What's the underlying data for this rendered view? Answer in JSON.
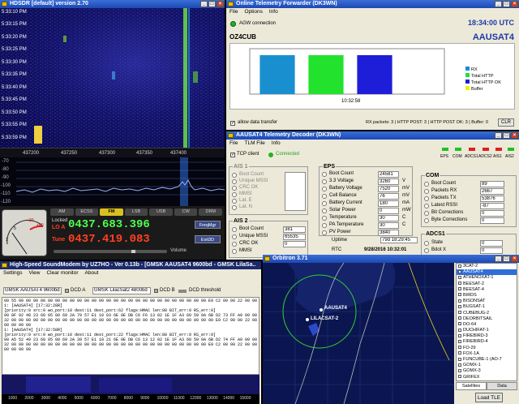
{
  "hdsdr": {
    "title": "HDSDR [default] version 2.70",
    "times": [
      "5:33:10 PM",
      "5:33:15 PM",
      "5:33:20 PM",
      "5:33:25 PM",
      "5:33:30 PM",
      "5:33:35 PM",
      "5:33:40 PM",
      "5:33:45 PM",
      "5:33:50 PM",
      "5:33:55 PM",
      "5:33:59 PM"
    ],
    "freq_ticks": [
      "437200",
      "437250",
      "437300",
      "437350",
      "437400"
    ],
    "db_ticks": [
      "-70",
      "-80",
      "-90",
      "-100",
      "-110",
      "-120"
    ],
    "modes": [
      "AM",
      "ECSS",
      "FM",
      "LSB",
      "USB",
      "CW",
      "DRM"
    ],
    "active_mode": "FM",
    "lo_label": "LO A",
    "lo_freq": "0437.683.396",
    "tune_label": "Tune",
    "tune_freq": "0437.419.083",
    "locked": "Locked",
    "freqmgr": "FreqMgr",
    "exit": "Exit3D",
    "volume_label": "Volume",
    "meter_scale": [
      "1",
      "3",
      "5",
      "7",
      "9",
      "+20",
      "+40",
      "+60"
    ]
  },
  "otf": {
    "title": "Online Telemetry Forwarder (DK3WN)",
    "menu": [
      "File",
      "Options",
      "Info"
    ],
    "clock": "18:34:00 UTC",
    "agw": "AGW connection",
    "callsign": "OZ4CUB",
    "sat": "AAUSAT4",
    "chart_time": "10:32:58",
    "allow": "allow data transfer",
    "status": "RX packets: 3 | HTTP POST: 3 | HTTP POST OK: 3 | Buffer: 0",
    "clr": "CLR",
    "chart_data": {
      "type": "bar",
      "title": "",
      "categories": [
        "RX",
        "Total HTTP",
        "Total HTTP OK",
        "Buffer"
      ],
      "values": [
        3,
        3,
        3,
        0
      ],
      "colors": [
        "#1a8fd0",
        "#22e22e",
        "#1e1ed8",
        "#f0f000"
      ],
      "ylim": [
        0,
        3.5
      ],
      "xlabel": "",
      "ylabel": "",
      "legend": "right",
      "grid": false
    }
  },
  "decoder": {
    "title": "AAUSAT4 Telemetry Decoder (DK3WN)",
    "menu": [
      "File",
      "TLM File",
      "Info"
    ],
    "tcp": "TCP client",
    "connected": "Connected",
    "leds": [
      "EPS",
      "COM",
      "ADCS1",
      "ADCS2",
      "AIS1",
      "AIS2"
    ],
    "ais1": {
      "title": "AIS 1",
      "rows": [
        "Boot Count",
        "Unique MSSI",
        "CRC OK",
        "MMSI",
        "Lat. E",
        "Lat. N"
      ]
    },
    "ais2": {
      "title": "AIS 2",
      "rows": [
        {
          "k": "Boot Count",
          "v": "381"
        },
        {
          "k": "Unique MSSI",
          "v": "65535"
        },
        {
          "k": "CRC OK",
          "v": "0"
        },
        {
          "k": "MMSI",
          "v": ""
        }
      ]
    },
    "eps": {
      "title": "EPS",
      "rows": [
        {
          "k": "Boot Count",
          "v": "24581",
          "u": ""
        },
        {
          "k": "3.3 Voltage",
          "v": "3260",
          "u": "V"
        },
        {
          "k": "Battery Voltage",
          "v": "7520",
          "u": "mV"
        },
        {
          "k": "Cell Balance",
          "v": "76",
          "u": "mV"
        },
        {
          "k": "Battery Current",
          "v": "180",
          "u": "mA"
        },
        {
          "k": "Solar Power",
          "v": "0",
          "u": "mW"
        },
        {
          "k": "Temperature",
          "v": "30",
          "u": "C"
        },
        {
          "k": "PA Temperature",
          "v": "30",
          "u": "C"
        },
        {
          "k": "PV Power",
          "v": "3840",
          "u": ""
        }
      ]
    },
    "com": {
      "title": "COM",
      "rows": [
        {
          "k": "Boot Count",
          "v": "89"
        },
        {
          "k": "Packets RX",
          "v": "2667"
        },
        {
          "k": "Packets TX",
          "v": "53876"
        },
        {
          "k": "Latest RSSI",
          "v": "-87"
        },
        {
          "k": "Bit Corrections",
          "v": "0"
        },
        {
          "k": "Byte Corrections",
          "v": "0"
        }
      ]
    },
    "adcs1": {
      "title": "ADCS1",
      "rows": [
        {
          "k": "State",
          "v": "0"
        },
        {
          "k": "Bdot X",
          "v": "0"
        }
      ]
    },
    "uptime_label": "Uptime",
    "uptime": "79d 18:29:45",
    "rtc_label": "RTC",
    "rtc": "9/28/2016 10:32:01"
  },
  "modem": {
    "title": "High-Speed SoundModem by UZ7HO - Ver 0.13b - [GMSK AAUSAT4 9600bd - GMSK LilaSa..",
    "menu": [
      "Settings",
      "View",
      "Clear monitor",
      "About"
    ],
    "mode_a": "GMSK AAUSAT4 9600bd",
    "dcd_a": "DCD A",
    "mode_b": "GMSK LilacSat2 4800bd",
    "dcd_b": "DCD B",
    "dcd_thr": "DCD threshold",
    "monitor": [
      "00 55 00 00 00 00 00 00 00 00 00 00 00 00 00 00 00 00 00 00 00 00 00 00 00 00 00 00 E9 C2 00 00 22 00 00 00 30 00 9F 80 E6 15",
      "",
      "1: [AAUSAT4] [17:32:28R]",
      "[priority:0 src:0 wo_port:10 dest:11 dest_port:62 flags:HMAC len:88 BIT_err:0 RS_err:0]",
      "00 8F 92 48 23 60 05 00 69 2A 79 57 E1 10 03 6E 0E DB C6 F6 13 02 1E 1F A3 60 59 0A 6B D2 73 FF A9 00 00 00 FF 9C 00 6F 02",
      "32 00 00 00 00 00 00 00 00 00 00 00 00 00 00 00 00 00 00 00 00 00 00 00 00 00 00 00 00 E9 C2 00 00 22 00 00 FF 30 00 00 00 00",
      "00 00 00 00",
      "",
      "1: [AAUSAT4] [17:32:58R]",
      "[priority:0 src:0 wo_port:10 dest:11 dest_port:22 flags:HMAC len:88 BIT_err:0 RS_err:0]",
      "00 A5 52 49 23 60 05 00 69 2A 39 57 E1 10 21 6E 0E DB C6 13 12 02 1E 1F A3 60 59 0A 6B D2 74 FF A9 00 00 FF 9C 00 6F 02",
      "32 00 00 00 00 00 00 00 00 00 00 00 00 00 00 00 00 00 00 00 00 00 00 00 00 00 00 00 E9 C2 00 00 22 00 00 00 FF 30 00 00 00 00",
      "00 00 00 00"
    ],
    "spec_ticks": [
      "1000",
      "2000",
      "3000",
      "4000",
      "5000",
      "6000",
      "7000",
      "8000",
      "9000",
      "10000",
      "11000",
      "12000",
      "13000",
      "14000",
      "15000"
    ]
  },
  "orbitron": {
    "title": "Orbitron 3.71",
    "sats": [
      "3CAT-2",
      "AAUSAT4",
      "ATHENOXAT-1",
      "BEESAT-2",
      "BEESAT-4",
      "BIRDS",
      "BISONSAT",
      "BUGSAT-1",
      "CUBEBUG-2",
      "DEORBITSAIL",
      "DO-64",
      "DUCHIFAT-1",
      "FIREBIRD-3",
      "FIREBIRD-4",
      "FO-29",
      "FOX-1A",
      "FUNCUBE-1 (AO-7",
      "GOMX-1",
      "GOMX-3",
      "GRIFEX"
    ],
    "selected": "AAUSAT4",
    "tabs": [
      "Satellites",
      "Data"
    ],
    "load_tle": "Load TLE",
    "sat_labels": [
      "AAUSAT4",
      "LILACSAT-2"
    ]
  },
  "colors": {
    "accent": "#2f6ed8",
    "tune_red": "#ff4020",
    "lo_green": "#50ff50"
  }
}
